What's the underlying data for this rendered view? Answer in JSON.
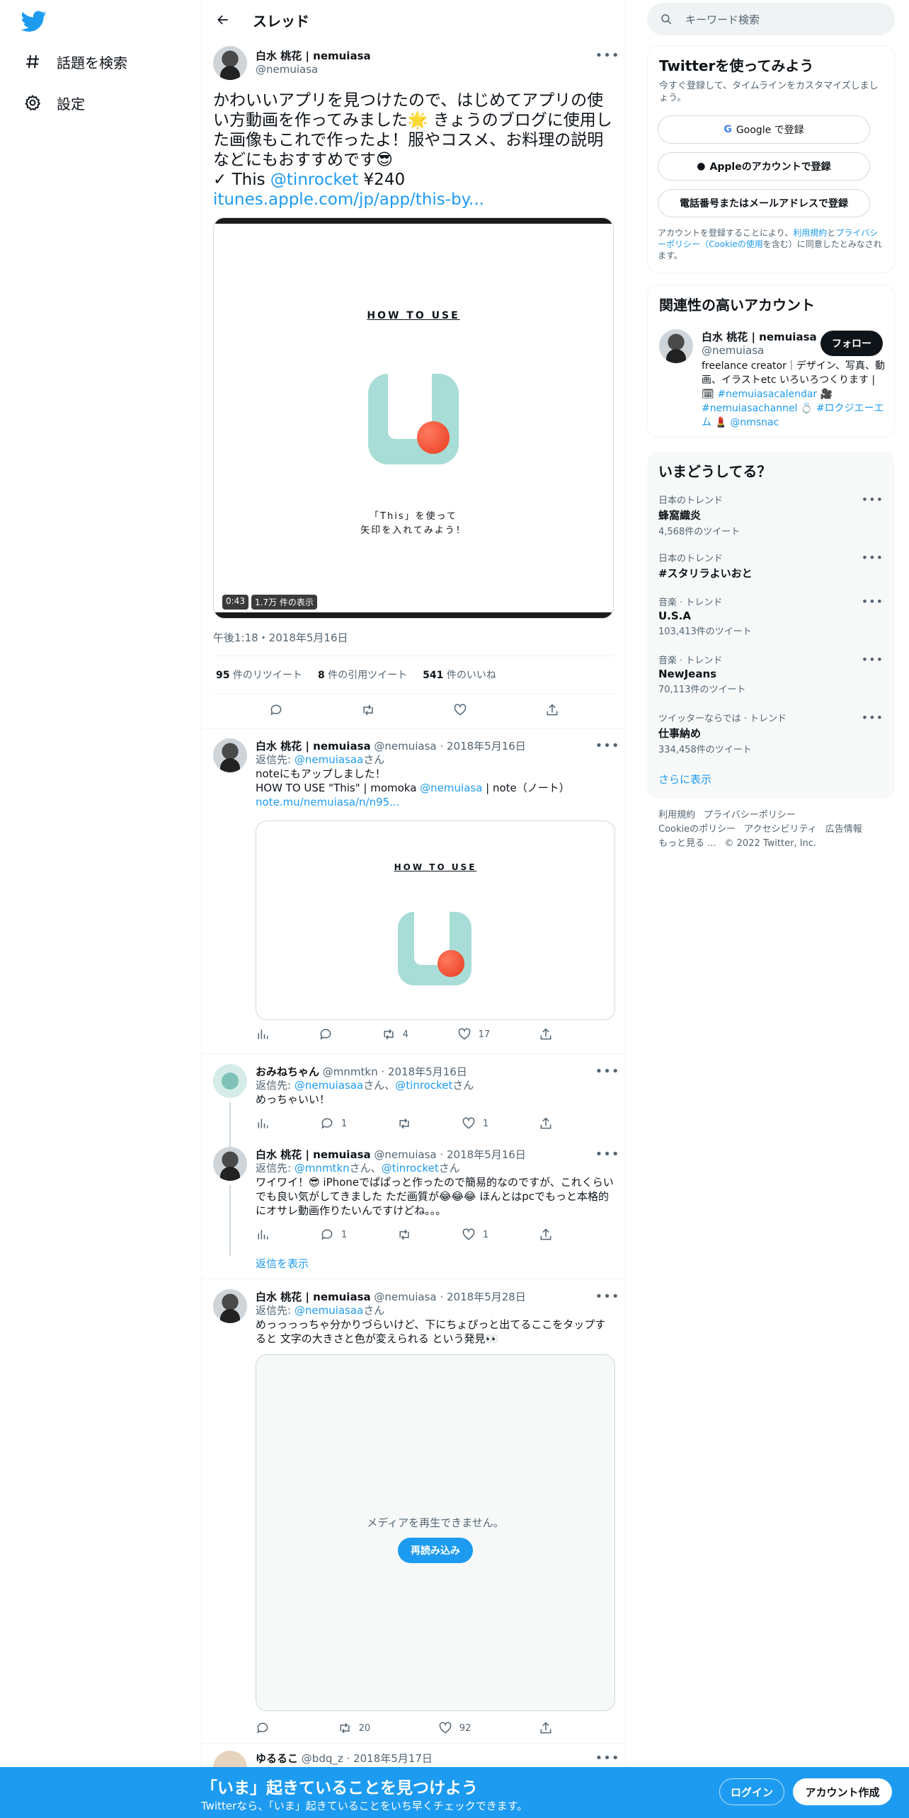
{
  "nav": {
    "explore_label": "話題を検索",
    "settings_label": "設定"
  },
  "header": {
    "title": "スレッド"
  },
  "tweet": {
    "name": "白水 桃花 | nemuiasa",
    "handle": "@nemuiasa",
    "text_line1": "かわいいアプリを見つけたので、はじめてアプリの使い方動画を作ってみました🌟 きょうのブログに使用した画像もこれで作ったよ！服やコスメ、お料理の説明などにもおすすめです😎",
    "text_check": "✓ This",
    "text_mention": "@tinrocket",
    "text_price": "¥240",
    "text_link": "itunes.apple.com/jp/app/this-by...",
    "video": {
      "howto": "HOW TO USE",
      "caption_line1": "「This」を使って",
      "caption_line2": "矢印を入れてみよう！",
      "duration": "0:43",
      "views": "1.7万 件の表示"
    },
    "timestamp": "午後1:18・2018年5月16日",
    "retweets": {
      "count": "95",
      "label": "件のリツイート"
    },
    "quotes": {
      "count": "8",
      "label": "件の引用ツイート"
    },
    "likes": {
      "count": "541",
      "label": "件のいいね"
    }
  },
  "replies": [
    {
      "name": "白水 桃花 | nemuiasa",
      "handle": "@nemuiasa",
      "date": "2018年5月16日",
      "reply_prefix": "返信先: ",
      "reply_to": "@nemuiasaa",
      "reply_suffix": "さん",
      "text1": "noteにもアップしました！",
      "text2a": "HOW TO USE \"This\" | momoka ",
      "text2_mention": "@nemuiasa",
      "text2b": " | note（ノート）",
      "link": "note.mu/nemuiasa/n/n95...",
      "card_howto": "HOW TO USE",
      "retweets": "4",
      "likes": "17"
    },
    {
      "name": "おみねちゃん",
      "handle": "@mnmtkn",
      "date": "2018年5月16日",
      "reply_prefix": "返信先: ",
      "reply_to": "@nemuiasaa",
      "reply_mid": "さん、",
      "reply_to2": "@tinrocket",
      "reply_suffix": "さん",
      "text": "めっちゃいい！",
      "replies": "1",
      "likes": "1"
    },
    {
      "name": "白水 桃花 | nemuiasa",
      "handle": "@nemuiasa",
      "date": "2018年5月16日",
      "reply_prefix": "返信先: ",
      "reply_to": "@mnmtkn",
      "reply_mid": "さん、",
      "reply_to2": "@tinrocket",
      "reply_suffix": "さん",
      "text": "ワイワイ！😎 iPhoneでぱぱっと作ったので簡易的なのですが、これくらいでも良い気がしてきました ただ画質が😂😂😂 ほんとはpcでもっと本格的にオサレ動画作りたいんですけどね。。。",
      "replies": "1",
      "likes": "1",
      "show_replies": "返信を表示"
    },
    {
      "name": "白水 桃花 | nemuiasa",
      "handle": "@nemuiasa",
      "date": "2018年5月28日",
      "reply_prefix": "返信先: ",
      "reply_to": "@nemuiasaa",
      "reply_suffix": "さん",
      "text": "めっっっっちゃ分かりづらいけど、下にちょぴっと出てるここをタップすると 文字の大きさと色が変えられる という発見👀",
      "media_error": "メディアを再生できません。",
      "reload": "再読み込み",
      "retweets": "20",
      "likes": "92"
    },
    {
      "name": "ゆるるこ",
      "handle": "@bdq_z",
      "date": "2018年5月17日"
    }
  ],
  "sidebar": {
    "search_placeholder": "キーワード検索",
    "signup": {
      "title": "Twitterを使ってみよう",
      "subtitle": "今すぐ登録して、タイムラインをカスタマイズしましょう。",
      "google": "Google で登録",
      "apple": "Appleのアカウントで登録",
      "phone": "電話番号またはメールアドレスで登録",
      "terms_a": "アカウントを登録することにより、",
      "terms_link1": "利用規約",
      "terms_b": "と",
      "terms_link2": "プライバシーポリシー（Cookieの使用",
      "terms_c": "を含む）に同意したとみなされます。"
    },
    "related": {
      "title": "関連性の高いアカウント",
      "name": "白水 桃花 | nemuiasa",
      "handle": "@nemuiasa",
      "follow": "フォロー",
      "bio_a": "freelance creator｜デザイン、写真、動画、イラストetc いろいろつくります | 🗓 ",
      "bio_tag1": "#nemuiasacalendar",
      "bio_b": " 🎥 ",
      "bio_tag2": "#nemuiasachannel",
      "bio_c": " 💍 ",
      "bio_tag3": "#ロクジエーエム",
      "bio_d": " 💄 ",
      "bio_tag4": "@nmsnac"
    },
    "trends": {
      "title": "いまどうしてる？",
      "items": [
        {
          "context": "日本のトレンド",
          "topic": "蜂窩織炎",
          "count": "4,568件のツイート"
        },
        {
          "context": "日本のトレンド",
          "topic": "#スタリラよいおと",
          "count": ""
        },
        {
          "context": "音楽 · トレンド",
          "topic": "U.S.A",
          "count": "103,413件のツイート"
        },
        {
          "context": "音楽 · トレンド",
          "topic": "NewJeans",
          "count": "70,113件のツイート"
        },
        {
          "context": "ツイッターならでは · トレンド",
          "topic": "仕事納め",
          "count": "334,458件のツイート"
        }
      ],
      "show_more": "さらに表示"
    },
    "footer": {
      "terms": "利用規約",
      "privacy": "プライバシーポリシー",
      "cookie": "Cookieのポリシー",
      "accessibility": "アクセシビリティ",
      "ads": "広告情報",
      "more": "もっと見る ...",
      "copyright": "© 2022 Twitter, Inc."
    }
  },
  "bottom_bar": {
    "title": "「いま」起きていることを見つけよう",
    "subtitle": "Twitterなら、「いま」起きていることをいち早くチェックできます。",
    "login": "ログイン",
    "signup": "アカウント作成"
  },
  "colors": {
    "accent": "#1d9bf0",
    "text": "#0f1419",
    "muted": "#536471"
  }
}
